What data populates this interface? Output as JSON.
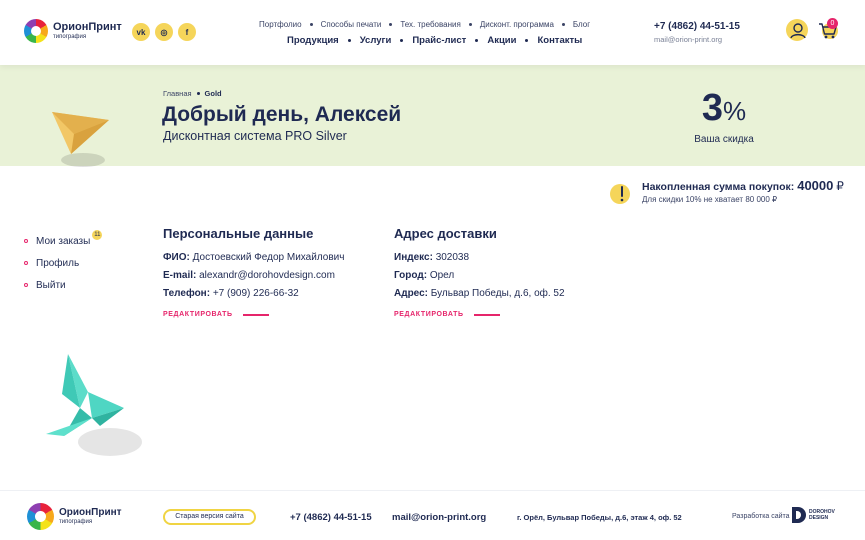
{
  "header": {
    "logo_name": "ОрионПринт",
    "logo_sub": "типография",
    "social": [
      {
        "icon": "vk-icon",
        "label": "vk"
      },
      {
        "icon": "instagram-icon",
        "label": "◎"
      },
      {
        "icon": "facebook-icon",
        "label": "f"
      }
    ],
    "nav_top": [
      "Портфолио",
      "Способы печати",
      "Тех. требования",
      "Дисконт. программа",
      "Блог"
    ],
    "nav_main": [
      "Продукция",
      "Услуги",
      "Прайс-лист",
      "Акции",
      "Контакты"
    ],
    "phone": "+7 (4862) 44-51-15",
    "email": "mail@orion-print.org",
    "cart_count": "0"
  },
  "banner": {
    "breadcrumb_home": "Главная",
    "breadcrumb_current": "Gold",
    "greeting": "Добрый день, Алексей",
    "level": "Дисконтная система PRO Silver",
    "discount_value": "3",
    "discount_unit": "%",
    "discount_label": "Ваша скидка"
  },
  "purchases": {
    "label": "Накопленная сумма покупок:",
    "amount": "40000",
    "currency": "₽",
    "note": "Для скидки 10% не хватает 80 000 ₽"
  },
  "side_menu": {
    "items": [
      {
        "label": "Мои заказы",
        "badge": "11"
      },
      {
        "label": "Профиль"
      },
      {
        "label": "Выйти"
      }
    ]
  },
  "personal": {
    "title": "Персональные данные",
    "rows": [
      {
        "label": "ФИО:",
        "value": "Достоевский Федор Михайлович"
      },
      {
        "label": "E-mail:",
        "value": "alexandr@dorohovdesign.com"
      },
      {
        "label": "Телефон:",
        "value": "+7 (909) 226-66-32"
      }
    ],
    "edit": "РЕДАКТИРОВАТЬ"
  },
  "delivery": {
    "title": "Адрес доставки",
    "rows": [
      {
        "label": "Индекс:",
        "value": "302038"
      },
      {
        "label": "Город:",
        "value": "Орел"
      },
      {
        "label": "Адрес:",
        "value": "Бульвар Победы, д.6, оф. 52"
      }
    ],
    "edit": "РЕДАКТИРОВАТЬ"
  },
  "footer": {
    "logo_name": "ОрионПринт",
    "logo_sub": "типография",
    "old_site": "Старая версия сайта",
    "phone": "+7 (4862) 44-51-15",
    "email": "mail@orion-print.org",
    "address": "г. Орёл, Бульвар Победы, д.6, этаж 4, оф. 52",
    "dev_label": "Разработка сайта",
    "dev_name_1": "DOROHOV",
    "dev_name_2": "DESIGN"
  },
  "colors": {
    "navy": "#1f2a52",
    "accent_pink": "#e6256b",
    "accent_yellow": "#f5d55a",
    "banner_bg": "#e9f2d7"
  }
}
